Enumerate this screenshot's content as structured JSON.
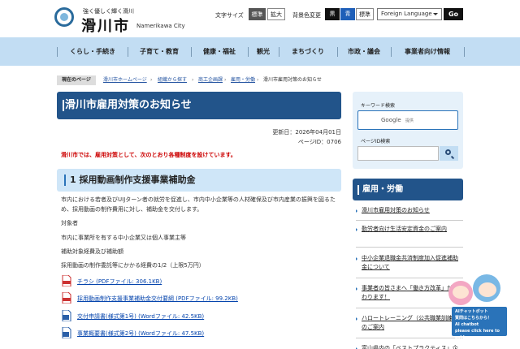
{
  "header": {
    "tagline": "強く優しく輝く滑川",
    "city_name": "滑川市",
    "city_en": "Namerikawa City",
    "font_size_label": "文字サイズ",
    "font_standard": "標準",
    "font_large": "拡大",
    "bg_color_label": "背景色変更",
    "bg_black": "黒",
    "bg_blue": "青",
    "bg_standard": "標準",
    "language": "Foreign Language",
    "go": "Go"
  },
  "nav": [
    "くらし・手続き",
    "子育て・教育",
    "健康・福祉",
    "観光",
    "まちづくり",
    "市政・議会",
    "事業者向け情報"
  ],
  "breadcrumb": {
    "label": "現在のページ",
    "items": [
      "滑川市ホームページ",
      "組織から探す",
      "商工企画課",
      "雇用・労働"
    ],
    "current": "滑川市雇用対策のお知らせ"
  },
  "main": {
    "title": "滑川市雇用対策のお知らせ",
    "updated": "更新日：2026年04月01日",
    "page_id": "ページID：0706",
    "intro": "滑川市では、雇用対策として、次のとおり各種制度を設けています。",
    "section1": {
      "heading": "1 採用動画制作支援事業補助金",
      "description": "市内における若者及びUIJターン者の就労を促進し、市内中小企業等の人材確保及び市内産業の振興を図るため、採用動画の制作費用に対し、補助金を交付します。",
      "lines": [
        "対象者",
        "市内に事業所を有する中小企業又は個人事業主等",
        "補助対象経費及び補助額",
        "採用動画の制作委託等にかかる経費の1/2（上限5万円）"
      ],
      "files": [
        {
          "label": "チラシ (PDFファイル: 306.1KB)",
          "type": "pdf"
        },
        {
          "label": "採用動画制作支援事業補助金交付要綱 (PDFファイル: 99.2KB)",
          "type": "pdf"
        },
        {
          "label": "交付申請書(様式第1号) (Wordファイル: 42.5KB)",
          "type": "word"
        },
        {
          "label": "事業概要書(様式第2号) (Wordファイル: 47.5KB)",
          "type": "word"
        }
      ]
    }
  },
  "sidebar": {
    "keyword_label": "キーワード検索",
    "google_text": "Google",
    "google_suffix": "提供",
    "pageid_label": "ページID検索",
    "section_title": "雇用・労働",
    "items": [
      "滑川市雇用対策のお知らせ",
      "勤労者向け生活安定資金のご案内",
      "中小企業退職金共済制度加入促進補助金について",
      "事業者の皆さまへ「働き方改革」が変わります！",
      "ハロートレーニング（公共職業訓練）のご案内",
      "富山県内の「ベストプラクティス」企業"
    ]
  },
  "chatbot": {
    "line1": "AIチャットボット",
    "line2": "質問はこちらから！",
    "line3": "AI chatbot",
    "line4": "please click here to ask!"
  },
  "colors": {
    "primary": "#22548a",
    "nav_bg": "#c2ddf3",
    "accent_red": "#cc0000",
    "heading_bg": "#cfe6f8"
  }
}
